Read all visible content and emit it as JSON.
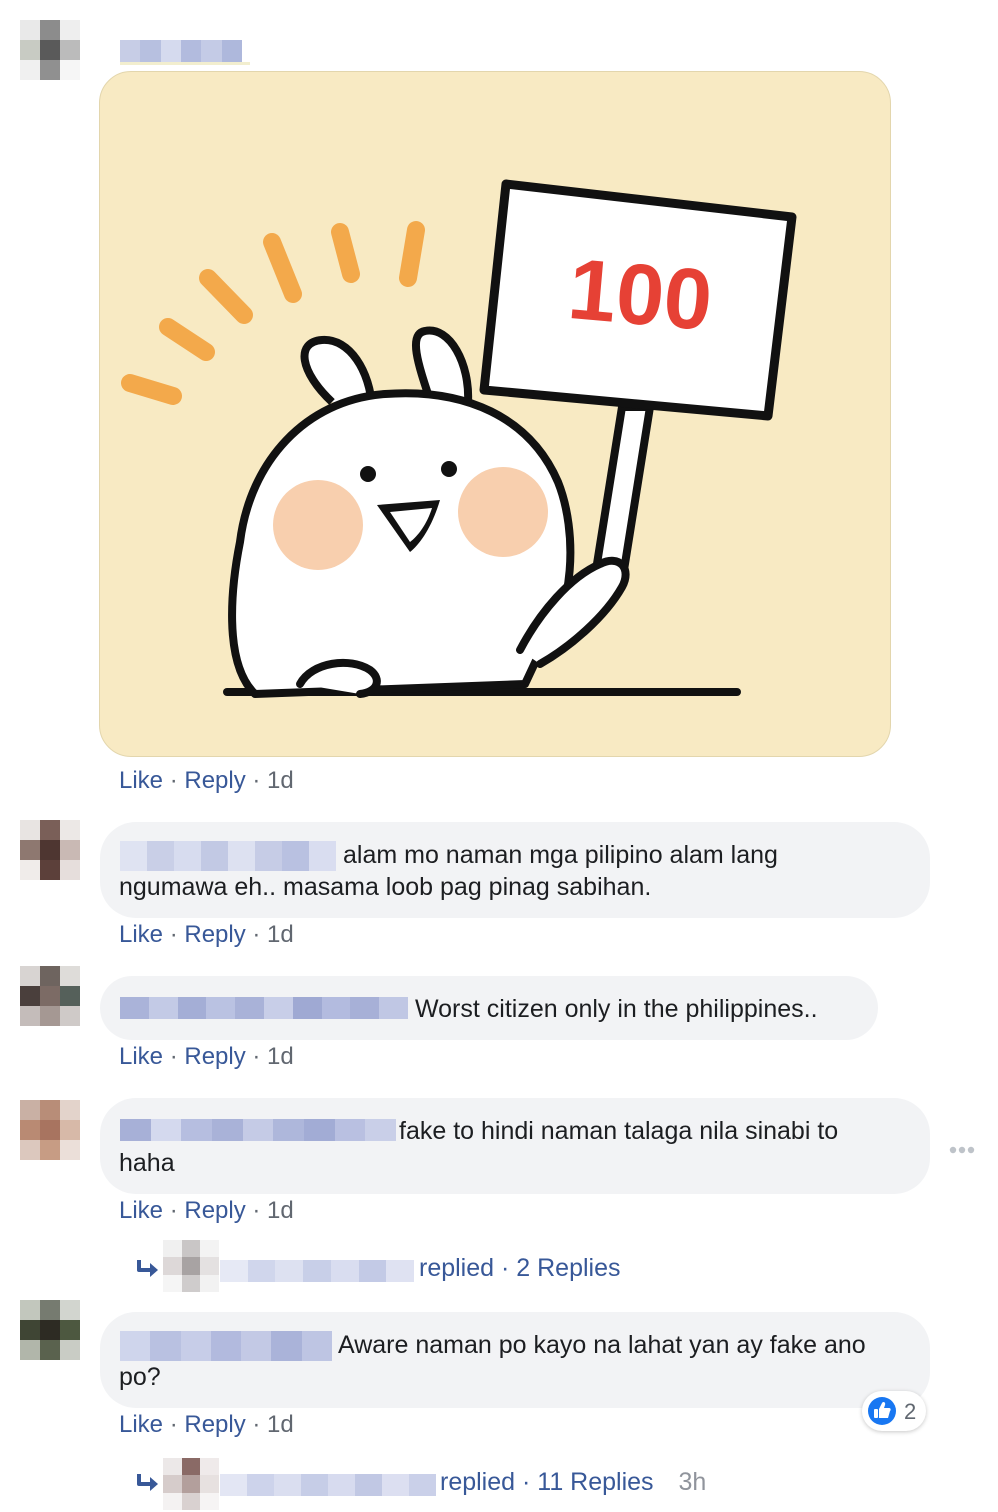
{
  "comments": [
    {
      "text_lines": [],
      "actions": {
        "like": "Like",
        "reply": "Reply",
        "sep": " · ",
        "time": "1d"
      },
      "has_sticker": true,
      "sticker": {
        "sign_text": "100"
      }
    },
    {
      "text_lines": [
        "alam mo naman mga pilipino alam lang",
        "ngumawa eh.. masama loob pag pinag sabihan."
      ],
      "actions": {
        "like": "Like",
        "reply": "Reply",
        "sep": " · ",
        "time": "1d"
      }
    },
    {
      "text_lines": [
        "Worst citizen only in the philippines.."
      ],
      "actions": {
        "like": "Like",
        "reply": "Reply",
        "sep": " · ",
        "time": "1d"
      }
    },
    {
      "text_lines": [
        "fake to hindi naman talaga nila sinabi to",
        "haha"
      ],
      "actions": {
        "like": "Like",
        "reply": "Reply",
        "sep": " · ",
        "time": "1d"
      },
      "replies": {
        "replied": "replied",
        "sep": " · ",
        "count_label": "2 Replies",
        "time": ""
      }
    },
    {
      "text_lines": [
        "Aware naman po kayo na lahat yan ay fake ano",
        "po?"
      ],
      "actions": {
        "like": "Like",
        "reply": "Reply",
        "sep": " · ",
        "time": "1d"
      },
      "reaction": {
        "icon": "like-thumb-icon",
        "count": "2"
      },
      "replies": {
        "replied": "replied",
        "sep": " · ",
        "count_label": "11 Replies",
        "time": "3h"
      }
    }
  ],
  "icons": {
    "more": "more-horizontal-icon",
    "reply_arrow": "reply-arrow-icon",
    "like": "like-thumb-icon"
  },
  "colors": {
    "link": "#385898",
    "bubble": "#f2f3f5",
    "like_blue": "#1877f2",
    "sticker_bg": "#f8eac3"
  }
}
